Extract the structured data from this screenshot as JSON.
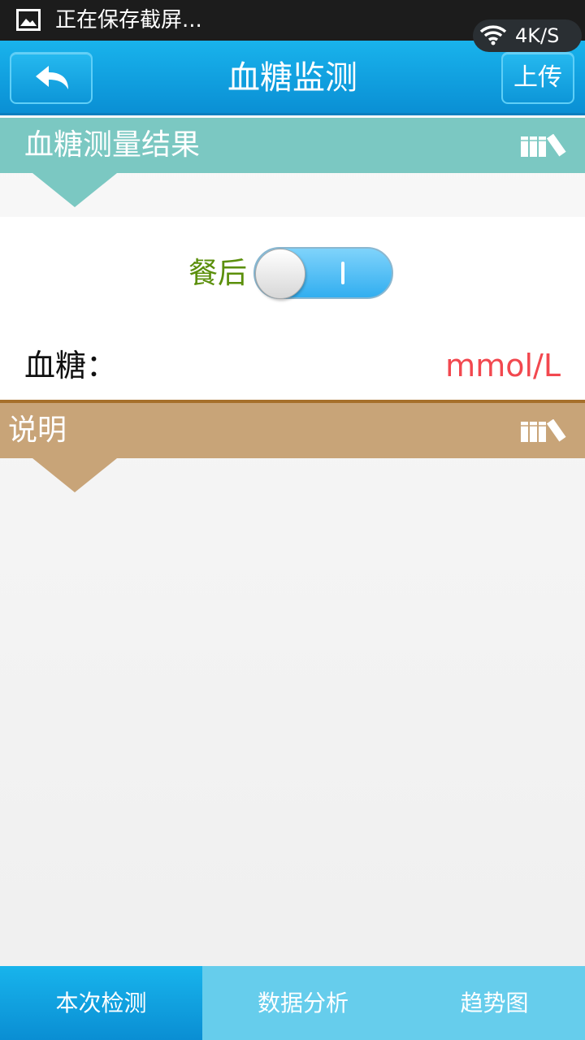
{
  "status_bar": {
    "notification": "正在保存截屏...",
    "network_speed": "4K/S"
  },
  "header": {
    "title": "血糖监测",
    "upload_label": "上传"
  },
  "result_section": {
    "title": "血糖测量结果",
    "meal_state_label": "餐后",
    "meal_toggle_on": true,
    "glucose_label": "血糖：",
    "glucose_unit": "mmol/L"
  },
  "description_section": {
    "title": "说明"
  },
  "tabs": [
    {
      "label": "本次检测",
      "active": true
    },
    {
      "label": "数据分析",
      "active": false
    },
    {
      "label": "趋势图",
      "active": false
    }
  ],
  "colors": {
    "header_blue": "#0a8fd4",
    "result_banner": "#7bc8c2",
    "description_banner": "#c8a478",
    "meal_label": "#5b8f0b",
    "unit_red": "#f2484f",
    "tab_bar": "#66cdec"
  }
}
